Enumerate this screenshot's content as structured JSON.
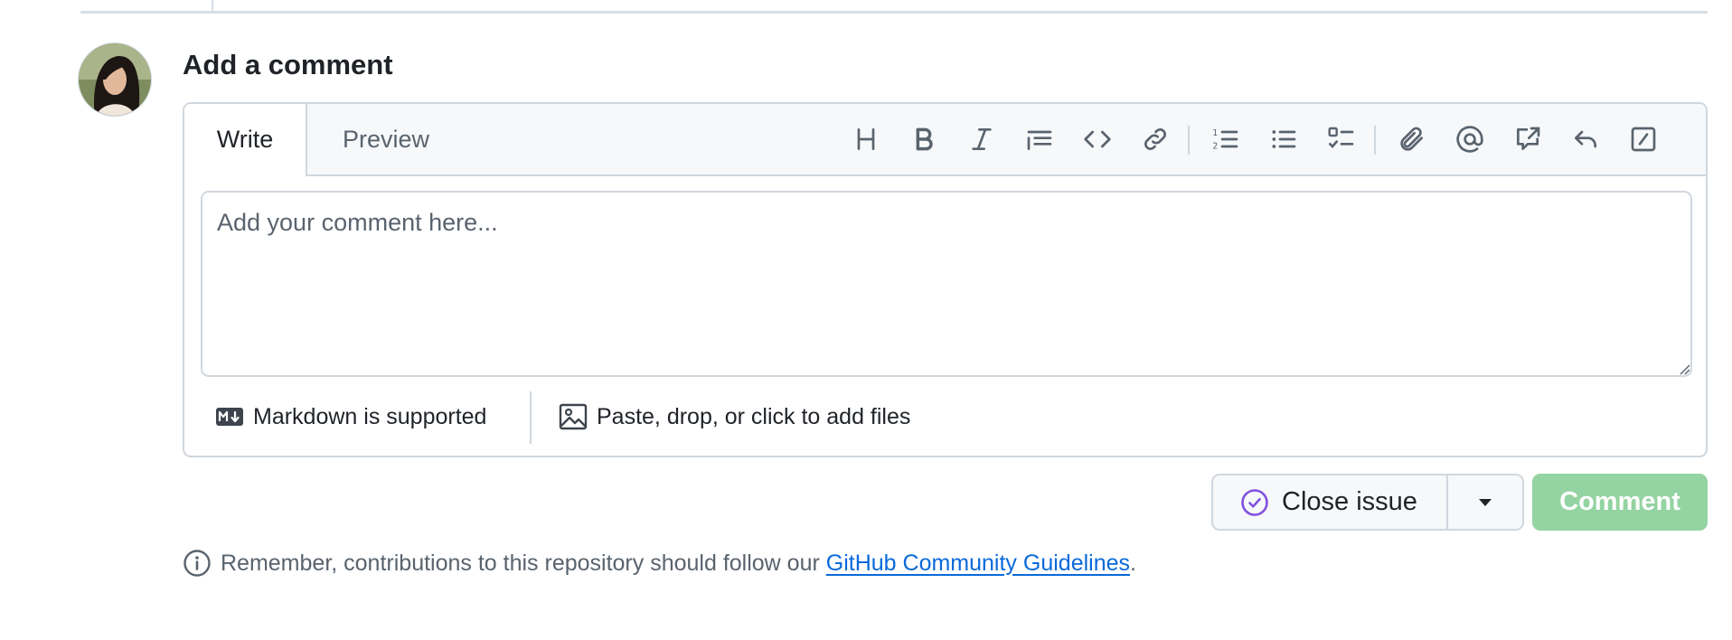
{
  "section": {
    "heading": "Add a comment"
  },
  "tabs": [
    {
      "label": "Write",
      "active": true
    },
    {
      "label": "Preview",
      "active": false
    }
  ],
  "toolbar": {
    "tools": [
      {
        "name": "heading",
        "icon": "heading-icon"
      },
      {
        "name": "bold",
        "icon": "bold-icon"
      },
      {
        "name": "italic",
        "icon": "italic-icon"
      },
      {
        "name": "quote",
        "icon": "quote-icon"
      },
      {
        "name": "code",
        "icon": "code-icon"
      },
      {
        "name": "link",
        "icon": "link-icon"
      },
      {
        "name": "numbered-list",
        "icon": "list-ordered-icon"
      },
      {
        "name": "unordered-list",
        "icon": "list-unordered-icon"
      },
      {
        "name": "task-list",
        "icon": "tasklist-icon"
      },
      {
        "name": "attach",
        "icon": "paperclip-icon"
      },
      {
        "name": "mention",
        "icon": "mention-icon"
      },
      {
        "name": "reference",
        "icon": "cross-reference-icon"
      },
      {
        "name": "saved-replies",
        "icon": "reply-icon"
      },
      {
        "name": "slash-commands",
        "icon": "slash-icon"
      }
    ]
  },
  "editor": {
    "placeholder": "Add your comment here...",
    "value": ""
  },
  "footer": {
    "markdown_label": "Markdown is supported",
    "files_label": "Paste, drop, or click to add files"
  },
  "actions": {
    "close_issue_label": "Close issue",
    "comment_label": "Comment"
  },
  "note": {
    "prefix": "Remember, contributions to this repository should follow our ",
    "link_text": "GitHub Community Guidelines",
    "suffix": "."
  },
  "colors": {
    "accent_link": "#0969da",
    "comment_button_disabled": "#94d3a2",
    "close_issue_icon": "#8250df",
    "border": "#d0d7de"
  }
}
